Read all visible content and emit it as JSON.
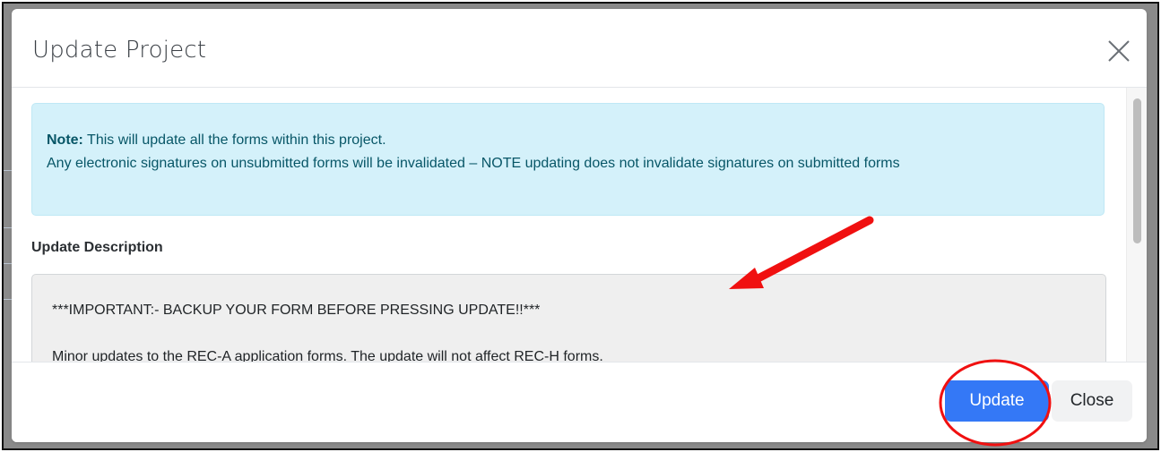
{
  "modal": {
    "title": "Update Project",
    "close_icon": "close-x-icon"
  },
  "alert": {
    "note_label": "Note:",
    "line1": "This will update all the forms within this project.",
    "line2": "Any electronic signatures on unsubmitted forms will be invalidated – NOTE updating does not invalidate signatures on submitted forms"
  },
  "description": {
    "heading": "Update Description",
    "lines": [
      "***IMPORTANT:- BACKUP YOUR FORM BEFORE PRESSING UPDATE!!***",
      "Minor updates to the REC-A application forms. The update will not affect REC-H forms."
    ]
  },
  "footer": {
    "update_label": "Update",
    "close_label": "Close"
  },
  "colors": {
    "primary": "#3478f6",
    "alert_bg": "#d4f1fa",
    "alert_text": "#075667",
    "annotation": "#f01010"
  },
  "annotations": {
    "arrow": "red-arrow-pointing-at-description",
    "circle": "red-circle-around-update-button"
  }
}
